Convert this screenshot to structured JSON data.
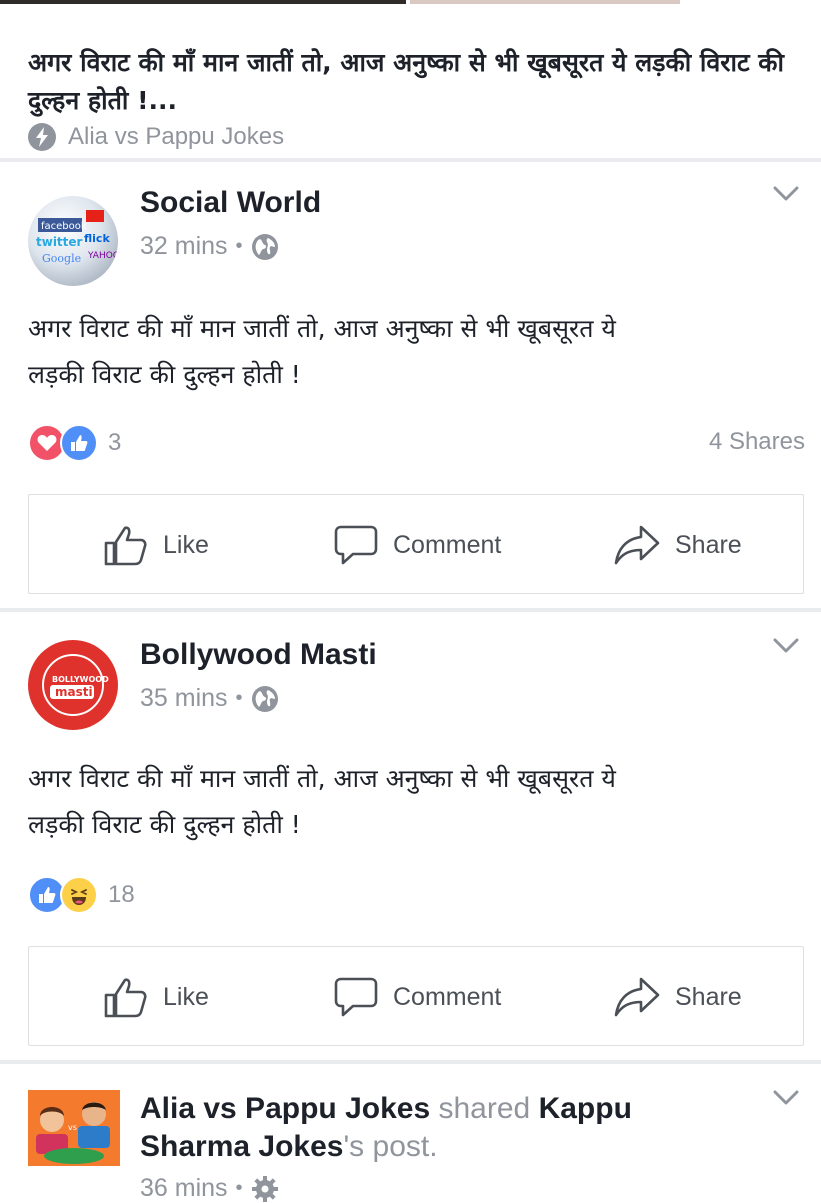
{
  "link_card": {
    "headline": "अगर विराट की माँ मान जातीं तो, आज अनुष्का से भी खूबसूरत ये लड़की विराट की दुल्हन होती !...",
    "source": "Alia vs Pappu Jokes",
    "source_icon": "bolt-icon"
  },
  "posts": [
    {
      "author": "Social World",
      "time": "32 mins",
      "dot": "•",
      "privacy_icon": "globe-icon",
      "text_line1": "अगर विराट की माँ मान जातीं तो, आज अनुष्का से भी खूबसूरत ये",
      "text_line2": "लड़की विराट की दुल्हन होती !",
      "reactions": [
        "love",
        "like"
      ],
      "reaction_count": "3",
      "shares": "4 Shares"
    },
    {
      "author": "Bollywood Masti",
      "time": "35 mins",
      "dot": "•",
      "privacy_icon": "globe-icon",
      "text_line1": "अगर विराट की माँ मान जातीं तो, आज अनुष्का से भी खूबसूरत ये",
      "text_line2": "लड़की विराट की दुल्हन होती !",
      "reactions": [
        "like",
        "haha"
      ],
      "reaction_count": "18",
      "shares": ""
    },
    {
      "author": "Alia vs Pappu Jokes",
      "shared_word": "shared",
      "shared_page": "Kappu Sharma Jokes",
      "shared_suffix": "'s post.",
      "time": "36 mins",
      "dot": "•",
      "privacy_icon": "gear-icon"
    }
  ],
  "actions": {
    "like": "Like",
    "comment": "Comment",
    "share": "Share"
  },
  "colors": {
    "like_blue": "#4f8ff7",
    "love_red": "#f25268",
    "haha_yellow": "#fdd049",
    "meta_gray": "#90949c",
    "text": "#1d2129"
  }
}
